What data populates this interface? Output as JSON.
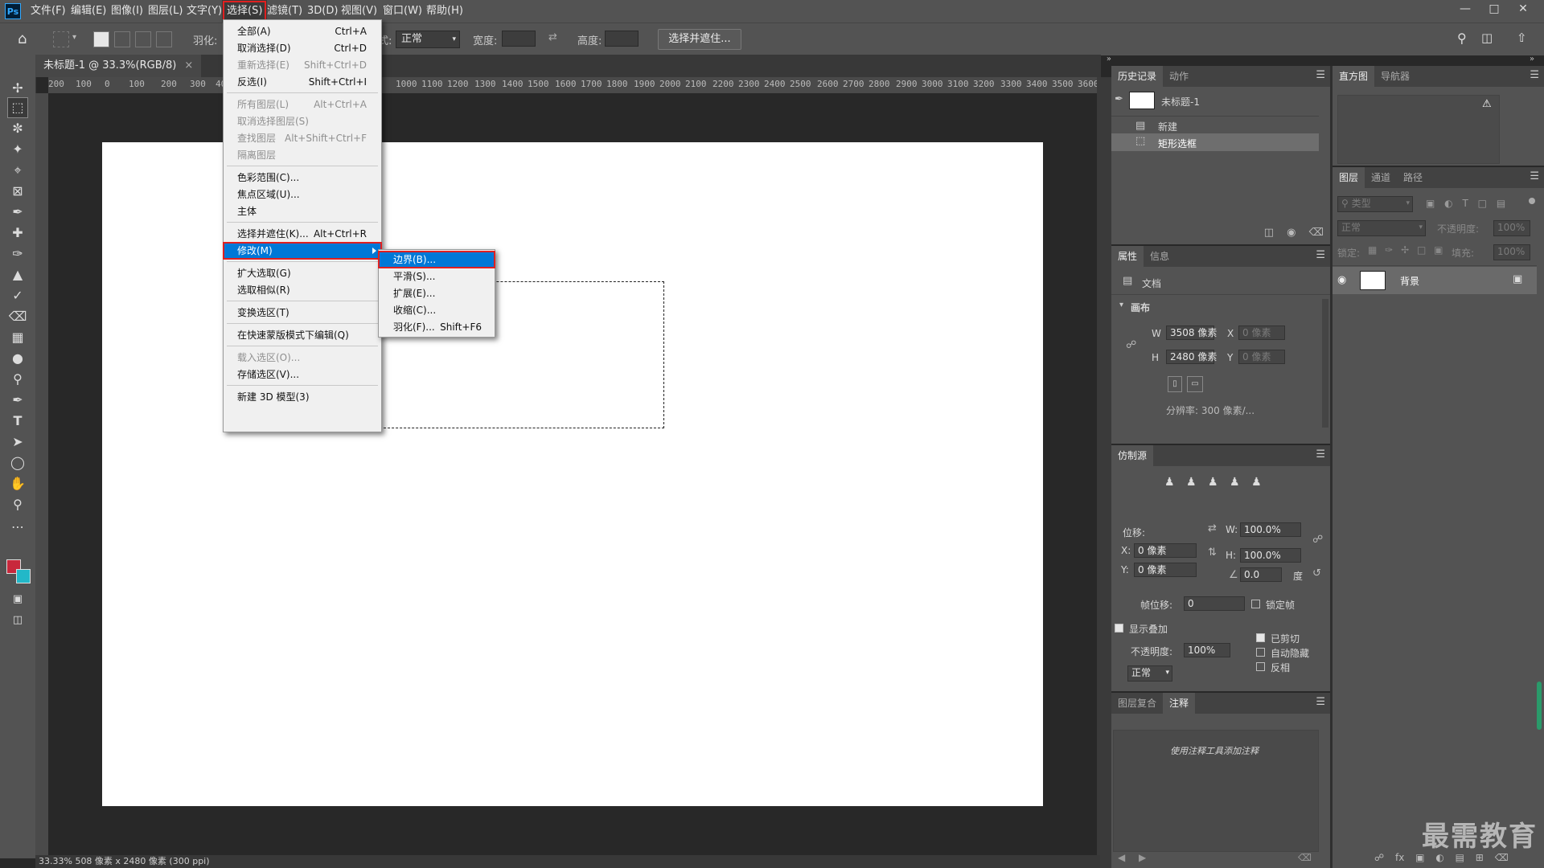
{
  "menubar": {
    "logo": "Ps",
    "items": [
      "文件(F)",
      "编辑(E)",
      "图像(I)",
      "图层(L)",
      "文字(Y)",
      "选择(S)",
      "滤镜(T)",
      "3D(D)",
      "视图(V)",
      "窗口(W)",
      "帮助(H)"
    ],
    "active_index": 5
  },
  "options": {
    "feather_label": "羽化:",
    "style_suffix": "式:",
    "style_value": "正常",
    "width_label": "宽度:",
    "height_label": "高度:",
    "select_mask_button": "选择并遮住..."
  },
  "document": {
    "tab_title": "未标题-1 @ 33.3%(RGB/8)",
    "status": "33.33% 508 像素 x 2480 像素 (300 ppi)",
    "ruler_h": [
      "200",
      "100",
      "0",
      "100",
      "200",
      "300",
      "400",
      "1000",
      "1100",
      "1200",
      "1300",
      "1400",
      "1500",
      "1600",
      "1700",
      "1800",
      "1900",
      "2000",
      "2100",
      "2200",
      "2300",
      "2400",
      "2500",
      "2600",
      "2700",
      "2800",
      "2900",
      "3000",
      "3100",
      "3200",
      "3300",
      "3400",
      "3500",
      "3600"
    ]
  },
  "select_menu": [
    {
      "label": "全部(A)",
      "shortcut": "Ctrl+A",
      "disabled": false
    },
    {
      "label": "取消选择(D)",
      "shortcut": "Ctrl+D",
      "disabled": false
    },
    {
      "label": "重新选择(E)",
      "shortcut": "Shift+Ctrl+D",
      "disabled": true
    },
    {
      "label": "反选(I)",
      "shortcut": "Shift+Ctrl+I",
      "disabled": false
    },
    {
      "label": "所有图层(L)",
      "shortcut": "Alt+Ctrl+A",
      "disabled": true
    },
    {
      "label": "取消选择图层(S)",
      "shortcut": "",
      "disabled": true
    },
    {
      "label": "查找图层",
      "shortcut": "Alt+Shift+Ctrl+F",
      "disabled": true
    },
    {
      "label": "隔离图层",
      "shortcut": "",
      "disabled": true
    },
    {
      "label": "色彩范围(C)...",
      "shortcut": "",
      "disabled": false
    },
    {
      "label": "焦点区域(U)...",
      "shortcut": "",
      "disabled": false
    },
    {
      "label": "主体",
      "shortcut": "",
      "disabled": false
    },
    {
      "label": "选择并遮住(K)...",
      "shortcut": "Alt+Ctrl+R",
      "disabled": false
    },
    {
      "label": "修改(M)",
      "shortcut": "",
      "disabled": false
    },
    {
      "label": "扩大选取(G)",
      "shortcut": "",
      "disabled": false
    },
    {
      "label": "选取相似(R)",
      "shortcut": "",
      "disabled": false
    },
    {
      "label": "变换选区(T)",
      "shortcut": "",
      "disabled": false
    },
    {
      "label": "在快速蒙版模式下编辑(Q)",
      "shortcut": "",
      "disabled": false
    },
    {
      "label": "载入选区(O)...",
      "shortcut": "",
      "disabled": true
    },
    {
      "label": "存储选区(V)...",
      "shortcut": "",
      "disabled": false
    },
    {
      "label": "新建 3D 模型(3)",
      "shortcut": "",
      "disabled": false
    }
  ],
  "modify_menu": [
    {
      "label": "边界(B)...",
      "shortcut": ""
    },
    {
      "label": "平滑(S)...",
      "shortcut": ""
    },
    {
      "label": "扩展(E)...",
      "shortcut": ""
    },
    {
      "label": "收缩(C)...",
      "shortcut": ""
    },
    {
      "label": "羽化(F)...",
      "shortcut": "Shift+F6"
    }
  ],
  "history": {
    "tabs": [
      "历史记录",
      "动作"
    ],
    "snapshot": "未标题-1",
    "items": [
      "新建",
      "矩形选框"
    ]
  },
  "histogram": {
    "tabs": [
      "直方图",
      "导航器"
    ]
  },
  "properties": {
    "tabs": [
      "属性",
      "信息"
    ],
    "doc_label": "文档",
    "section": "画布",
    "w_label": "W",
    "w_value": "3508 像素",
    "h_label": "H",
    "h_value": "2480 像素",
    "x_label": "X",
    "x_placeholder": "0 像素",
    "y_label": "Y",
    "y_placeholder": "0 像素",
    "resolution": "分辨率: 300 像素/..."
  },
  "clone": {
    "title": "仿制源",
    "offset_label": "位移:",
    "x_label": "X:",
    "x_value": "0 像素",
    "y_label": "Y:",
    "y_value": "0 像素",
    "w_label": "W:",
    "w_value": "100.0%",
    "h_label": "H:",
    "h_value": "100.0%",
    "angle_value": "0.0",
    "angle_unit": "度",
    "frame_offset_label": "帧位移:",
    "frame_offset_value": "0",
    "lock_frame": "锁定帧",
    "show_overlay": "显示叠加",
    "opacity_label": "不透明度:",
    "opacity_value": "100%",
    "clipped": "已剪切",
    "auto_hide": "自动隐藏",
    "invert": "反相",
    "blend_mode": "正常"
  },
  "notes": {
    "tabs": [
      "图层复合",
      "注释"
    ],
    "hint": "使用注释工具添加注释"
  },
  "layers": {
    "tabs": [
      "图层",
      "通道",
      "路径"
    ],
    "filter_placeholder": "类型",
    "blend_mode": "正常",
    "opacity_label": "不透明度:",
    "opacity_value": "100%",
    "lock_label": "锁定:",
    "fill_label": "填充:",
    "fill_value": "100%",
    "layer_name": "背景"
  },
  "watermark": "最需教育",
  "colors": {
    "foreground": "#c8283c",
    "background": "#22b8c8",
    "highlight": "#0078d7",
    "annotation_red": "#e02020"
  }
}
